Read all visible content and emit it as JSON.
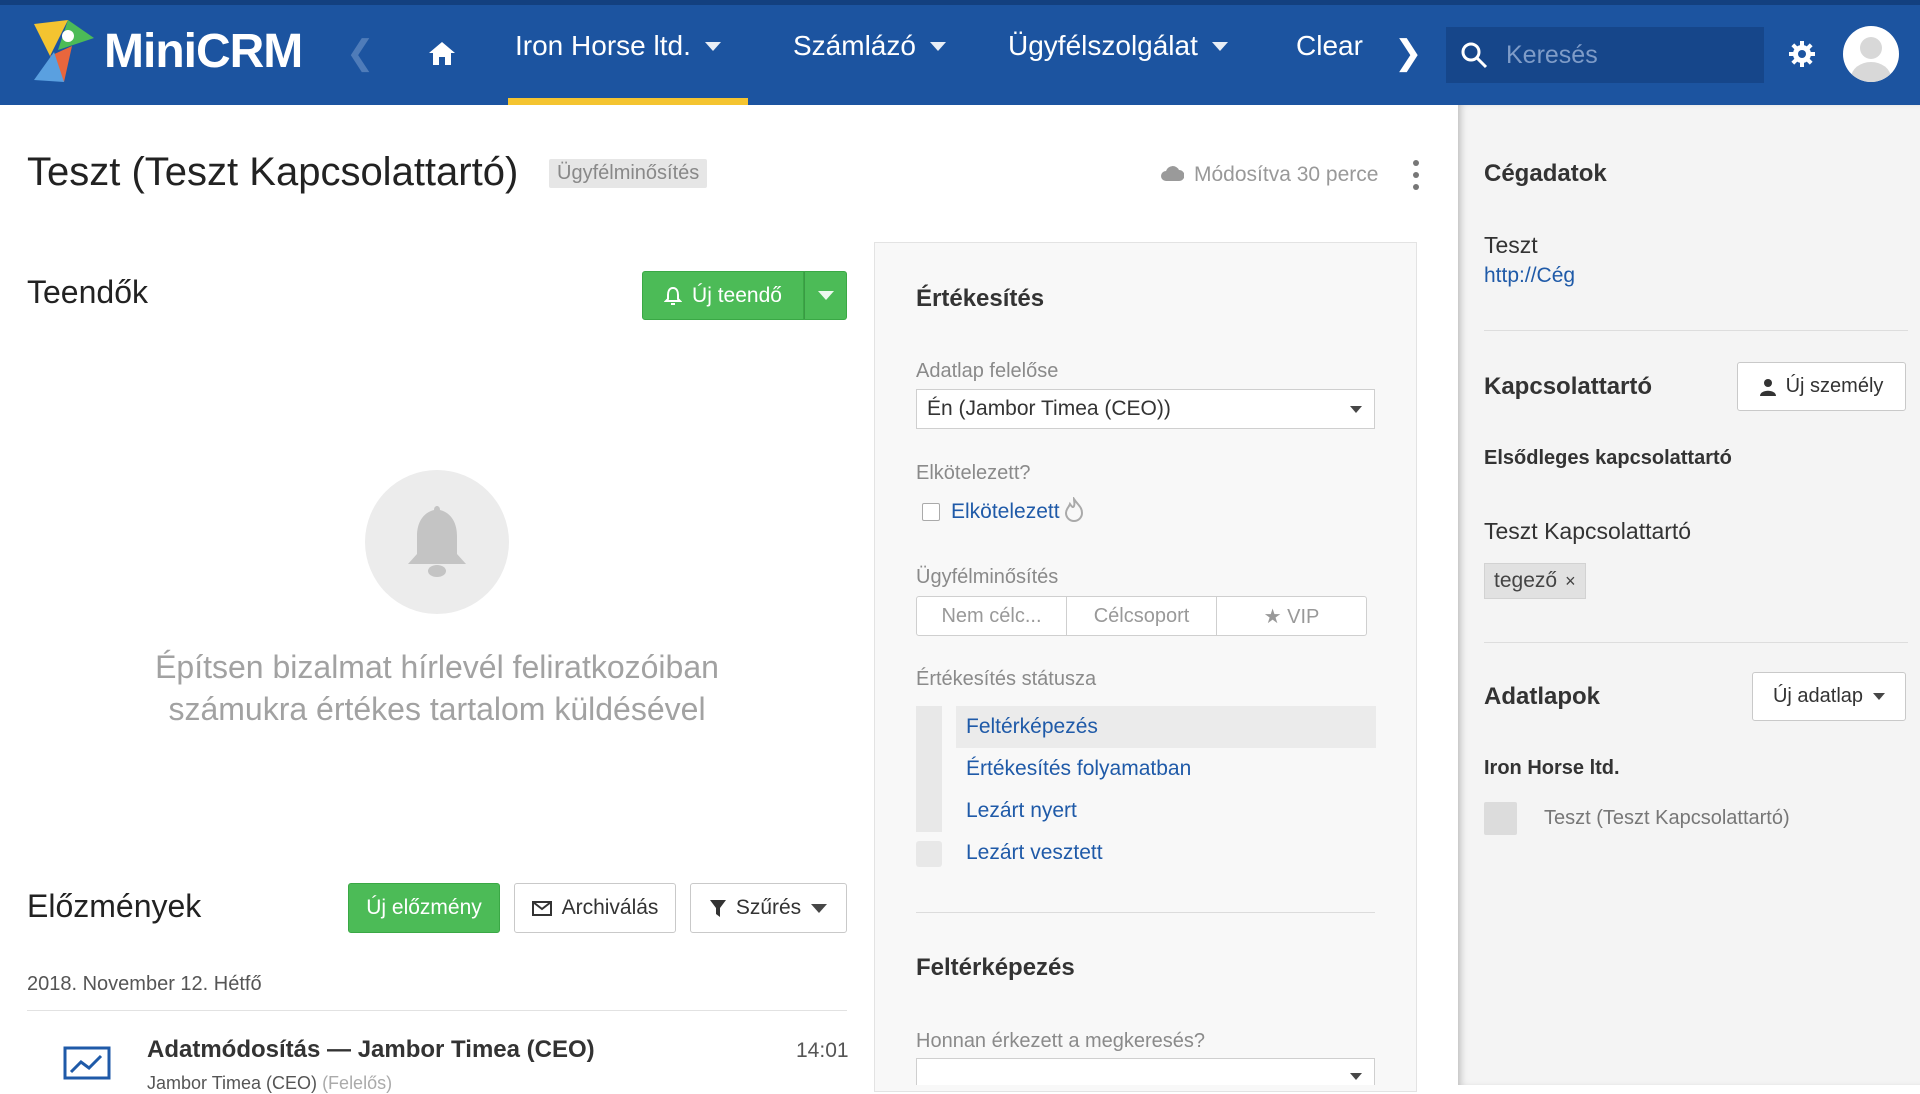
{
  "app": {
    "logo_text": "MiniCRM"
  },
  "nav": {
    "items": [
      {
        "label": "Iron Horse ltd.",
        "active": true
      },
      {
        "label": "Számlázó"
      },
      {
        "label": "Ügyfélszolgálat"
      },
      {
        "label": "Clear"
      }
    ],
    "search_placeholder": "Keresés"
  },
  "page": {
    "title": "Teszt (Teszt Kapcsolattartó)",
    "title_badge": "Ügyfélminősítés",
    "modified": "Módosítva 30 perce"
  },
  "todos": {
    "title": "Teendők",
    "new_button": "Új teendő",
    "empty_text_line1": "Építsen bizalmat hírlevél feliratkozóiban",
    "empty_text_line2": "számukra értékes tartalom küldésével"
  },
  "history": {
    "title": "Előzmények",
    "new_button": "Új előzmény",
    "archive_button": "Archiválás",
    "filter_button": "Szűrés",
    "date": "2018. November 12. Hétfő",
    "entry": {
      "title": "Adatmódosítás — Jambor Timea (CEO)",
      "time": "14:01",
      "sub": "Jambor Timea (CEO)",
      "sub_role": "(Felelős)"
    }
  },
  "sales": {
    "title": "Értékesítés",
    "owner_label": "Adatlap felelőse",
    "owner_value": "Én (Jambor Timea (CEO))",
    "committed_label": "Elkötelezett?",
    "committed_checkbox": "Elkötelezett",
    "rating_label": "Ügyfélminősítés",
    "rating_options": [
      "Nem célc...",
      "Célcsoport",
      "★ VIP"
    ],
    "status_label": "Értékesítés státusza",
    "statuses": [
      "Feltérképezés",
      "Értékesítés folyamatban",
      "Lezárt nyert",
      "Lezárt vesztett"
    ],
    "section2_title": "Feltérképezés",
    "source_label": "Honnan érkezett a megkeresés?"
  },
  "sidebar": {
    "company_title": "Cégadatok",
    "company_name": "Teszt",
    "company_url": "http://Cég",
    "contact_title": "Kapcsolattartó",
    "new_person_button": "Új személy",
    "primary_contact_label": "Elsődleges kapcsolattartó",
    "contact_name": "Teszt Kapcsolattartó",
    "contact_tag": "tegező",
    "sheets_title": "Adatlapok",
    "new_sheet_button": "Új adatlap",
    "sheet_company": "Iron Horse ltd.",
    "sheet_item": "Teszt (Teszt Kapcsolattartó)"
  },
  "colors": {
    "nav_bg": "#1c54a0",
    "accent": "#f4c430",
    "green": "#4cbb57",
    "link": "#1f5aa8"
  }
}
